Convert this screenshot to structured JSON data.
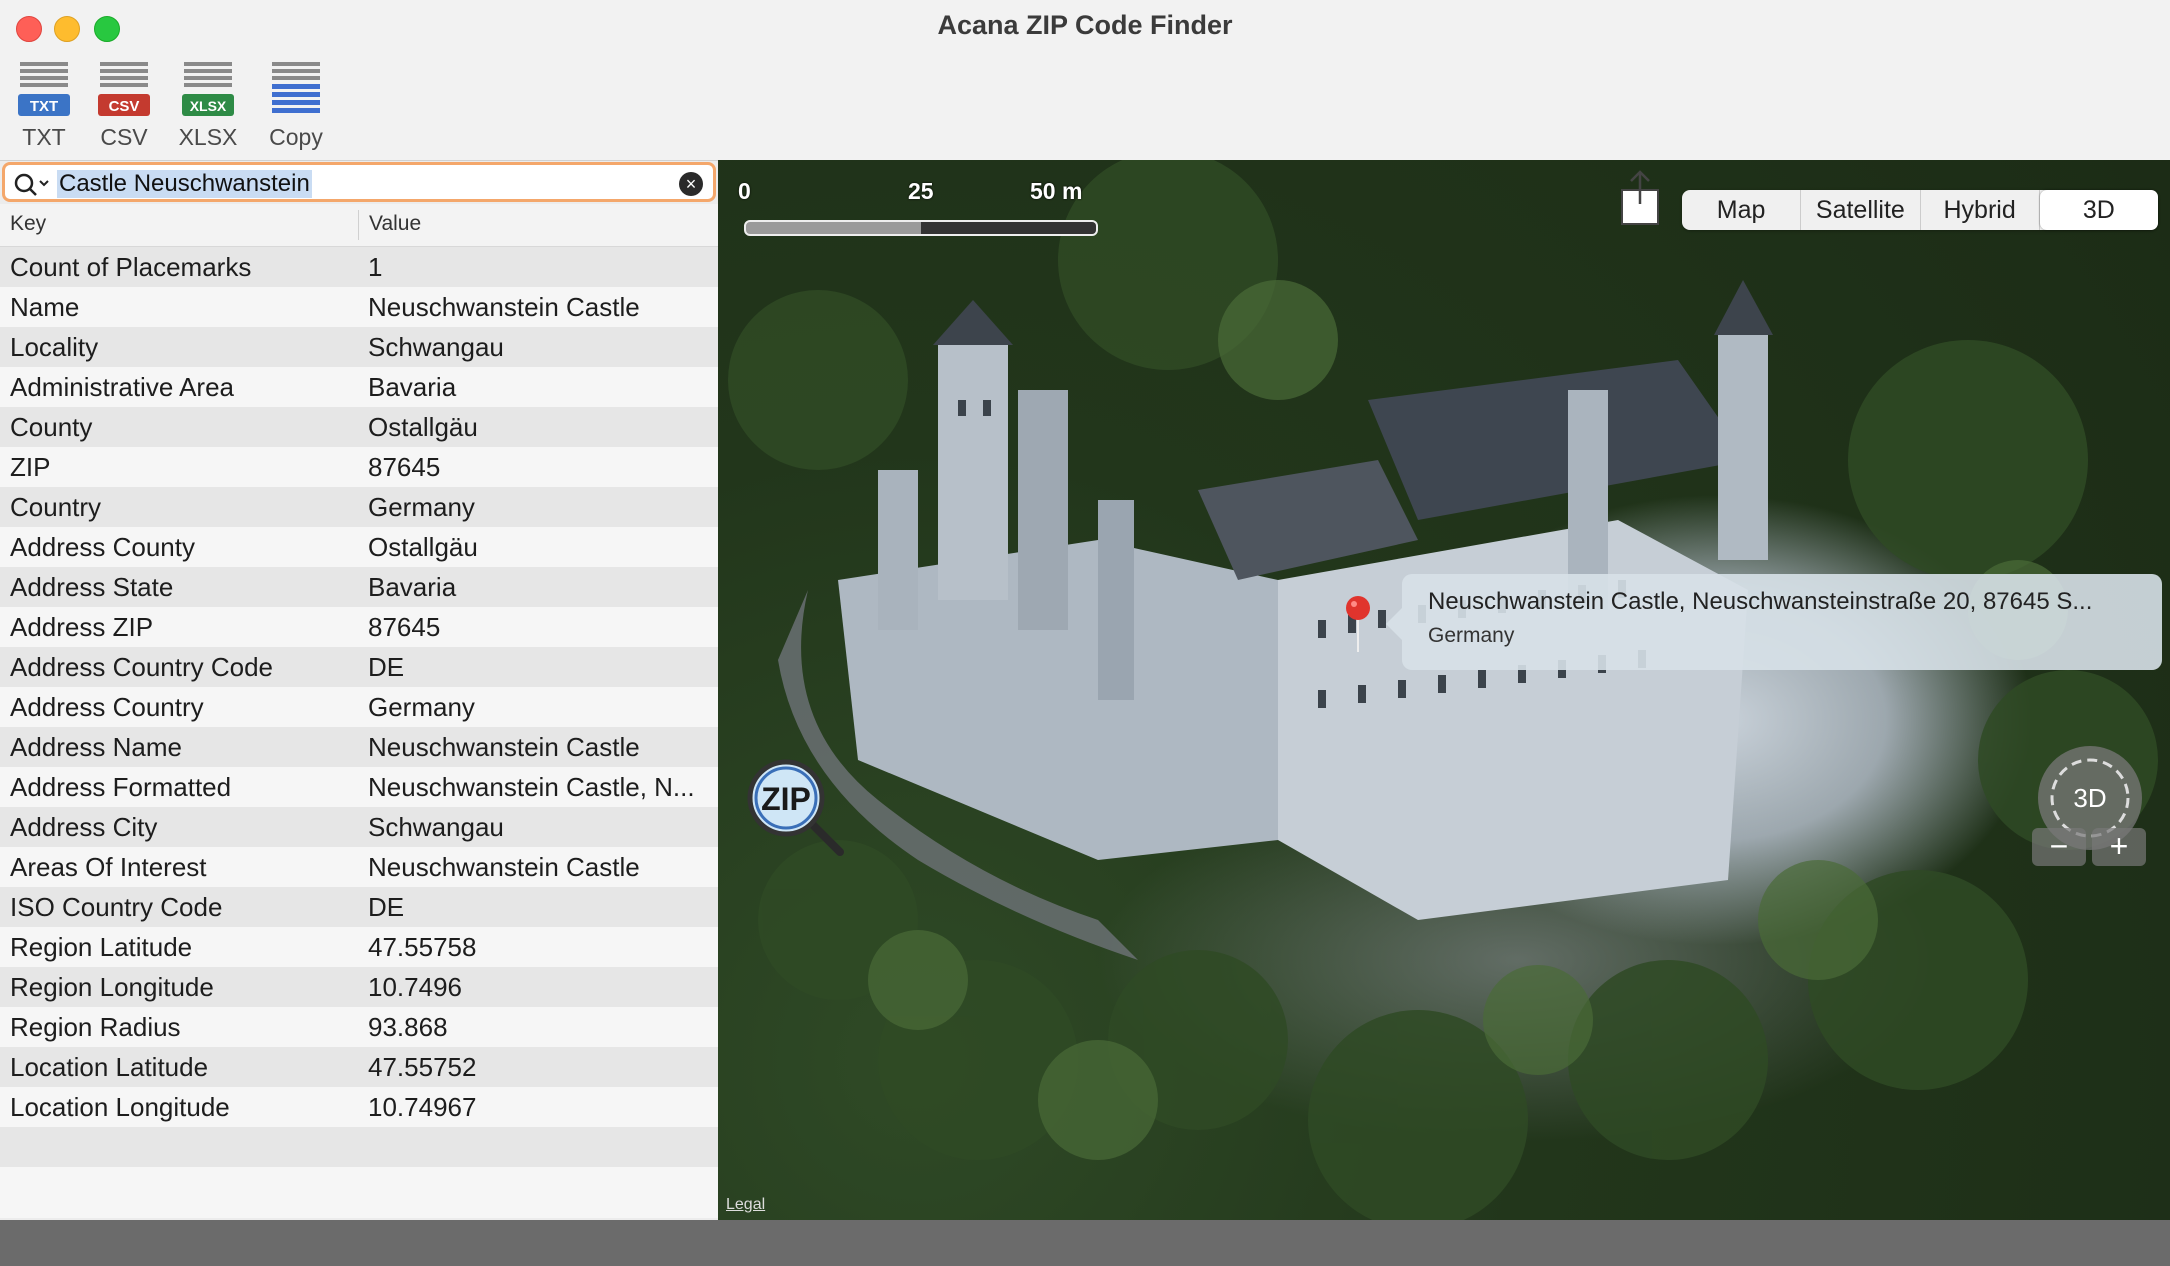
{
  "window": {
    "title": "Acana ZIP Code Finder"
  },
  "toolbar": {
    "txt": {
      "label": "TXT",
      "badge": "TXT",
      "color": "#3b74c6"
    },
    "csv": {
      "label": "CSV",
      "badge": "CSV",
      "color": "#c43a2f"
    },
    "xlsx": {
      "label": "XLSX",
      "badge": "XLSX",
      "color": "#2e8b46"
    },
    "copy": {
      "label": "Copy"
    }
  },
  "search": {
    "value": "Castle Neuschwanstein"
  },
  "table": {
    "headers": {
      "key": "Key",
      "value": "Value"
    },
    "rows": [
      {
        "key": "Count of Placemarks",
        "value": "1"
      },
      {
        "key": "Name",
        "value": "Neuschwanstein Castle"
      },
      {
        "key": "Locality",
        "value": "Schwangau"
      },
      {
        "key": "Administrative Area",
        "value": "Bavaria"
      },
      {
        "key": "County",
        "value": "Ostallgäu"
      },
      {
        "key": "ZIP",
        "value": "87645"
      },
      {
        "key": "Country",
        "value": "Germany"
      },
      {
        "key": "Address County",
        "value": "Ostallgäu"
      },
      {
        "key": "Address State",
        "value": "Bavaria"
      },
      {
        "key": "Address ZIP",
        "value": "87645"
      },
      {
        "key": "Address Country Code",
        "value": "DE"
      },
      {
        "key": "Address Country",
        "value": "Germany"
      },
      {
        "key": "Address Name",
        "value": "Neuschwanstein Castle"
      },
      {
        "key": "Address Formatted",
        "value": "Neuschwanstein Castle, N..."
      },
      {
        "key": "Address City",
        "value": "Schwangau"
      },
      {
        "key": "Areas Of Interest",
        "value": "Neuschwanstein Castle"
      },
      {
        "key": "ISO Country Code",
        "value": "DE"
      },
      {
        "key": "Region Latitude",
        "value": "47.55758"
      },
      {
        "key": "Region Longitude",
        "value": "10.7496"
      },
      {
        "key": "Region Radius",
        "value": "93.868"
      },
      {
        "key": "Location Latitude",
        "value": "47.55752"
      },
      {
        "key": "Location Longitude",
        "value": "10.74967"
      }
    ]
  },
  "map": {
    "scale": {
      "zero": "0",
      "mid": "25",
      "max": "50 m"
    },
    "modes": [
      "Map",
      "Satellite",
      "Hybrid",
      "3D"
    ],
    "active_mode": "3D",
    "callout": {
      "line1": "Neuschwanstein Castle, Neuschwansteinstraße 20, 87645 S...",
      "line2": "Germany"
    },
    "legal": "Legal",
    "compass_label": "3D",
    "zoom_out": "−",
    "zoom_in": "+",
    "logo_text": "ZIP"
  }
}
